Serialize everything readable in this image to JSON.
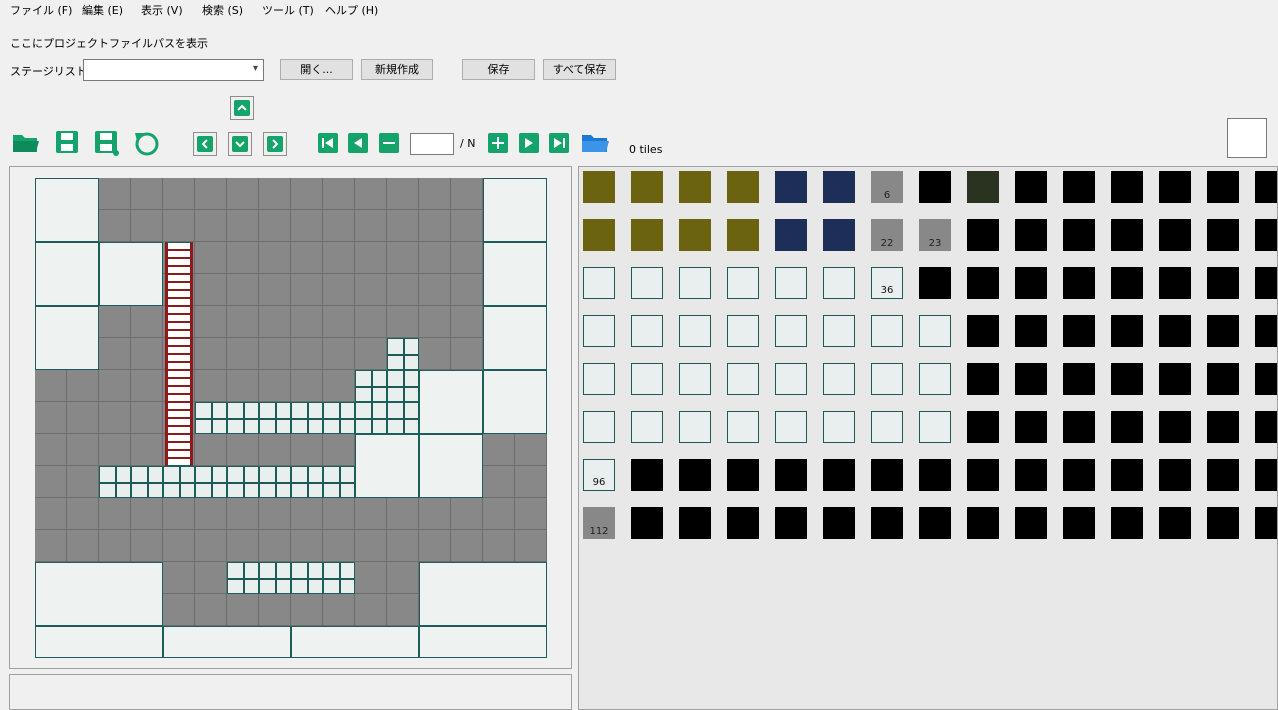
{
  "menu": [
    "ファイル (F)",
    "編集 (E)",
    "表示 (V)",
    "検索 (S)",
    "ツール (T)",
    "ヘルプ (H)"
  ],
  "project_path": "ここにプロジェクトファイルパスを表示",
  "stage_list_label": "ステージリスト",
  "stage_list_value": "",
  "buttons": {
    "open": "開く...",
    "new": "新規作成",
    "save": "保存",
    "save_all": "すべて保存"
  },
  "page": {
    "value": "",
    "suffix": "/ N"
  },
  "tile_count": "0 tiles",
  "tile_labels": [
    [
      "",
      "",
      "",
      "",
      "",
      "",
      "6",
      "",
      "",
      "",
      "",
      "",
      "",
      "",
      ""
    ],
    [
      "",
      "",
      "",
      "",
      "",
      "",
      "22",
      "23",
      "",
      "",
      "",
      "",
      "",
      "",
      ""
    ],
    [
      "",
      "",
      "",
      "",
      "",
      "",
      "36",
      "",
      "",
      "",
      "",
      "",
      "",
      "",
      ""
    ],
    [
      "",
      "",
      "",
      "",
      "",
      "",
      "",
      "",
      "",
      "",
      "",
      "",
      "",
      "",
      ""
    ],
    [
      "",
      "",
      "",
      "",
      "",
      "",
      "",
      "",
      "",
      "",
      "",
      "",
      "",
      "",
      ""
    ],
    [
      "",
      "",
      "",
      "",
      "",
      "",
      "",
      "",
      "",
      "",
      "",
      "",
      "",
      "",
      ""
    ],
    [
      "96",
      "",
      "",
      "",
      "",
      "",
      "",
      "",
      "",
      "",
      "",
      "",
      "",
      "",
      ""
    ],
    [
      "112",
      "",
      "",
      "",
      "",
      "",
      "",
      "",
      "",
      "",
      "",
      "",
      "",
      "",
      ""
    ]
  ],
  "colors": {
    "accent": "#14a36b",
    "folder": "#1b78d4",
    "map_background": "#888888",
    "tile_teal": "#1e5a55"
  }
}
